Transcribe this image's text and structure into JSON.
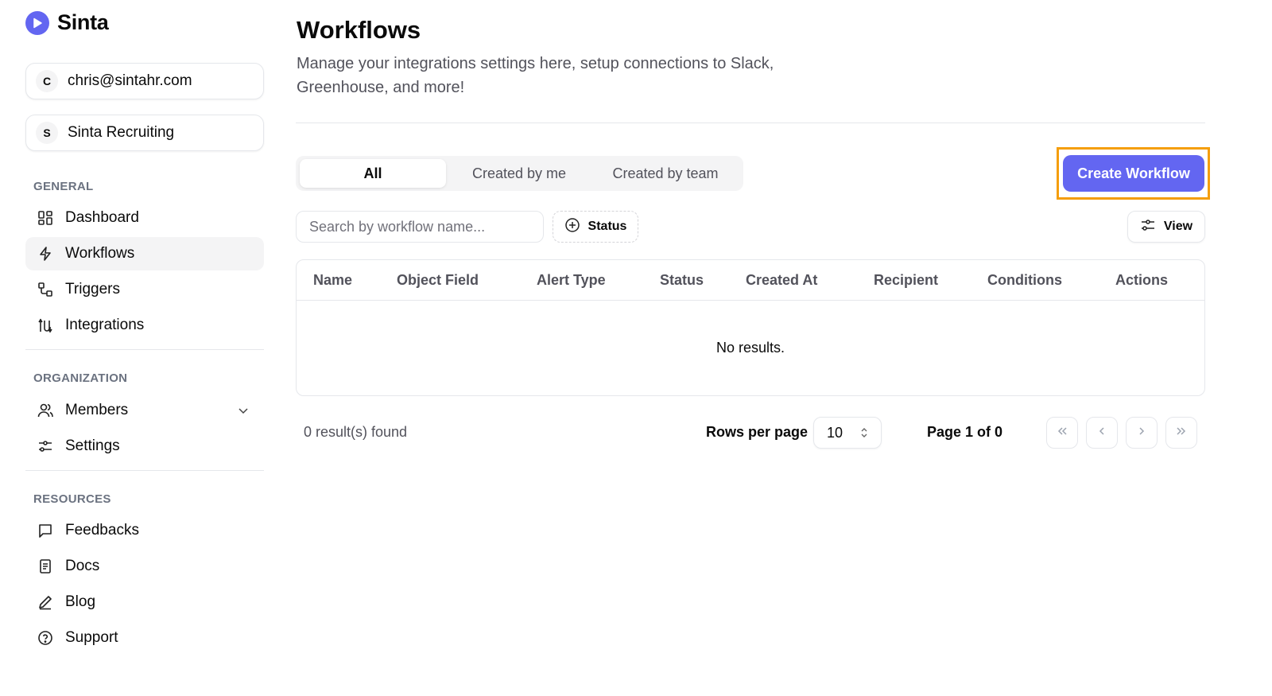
{
  "brand": {
    "name": "Sinta",
    "accent": "#6366f1"
  },
  "account": {
    "email_initial": "C",
    "email": "chris@sintahr.com",
    "org_initial": "S",
    "org": "Sinta Recruiting"
  },
  "sidebar": {
    "general_heading": "GENERAL",
    "general": [
      {
        "label": "Dashboard",
        "icon": "dashboard-icon"
      },
      {
        "label": "Workflows",
        "icon": "lightning-icon",
        "active": true
      },
      {
        "label": "Triggers",
        "icon": "triggers-icon"
      },
      {
        "label": "Integrations",
        "icon": "integrations-icon"
      }
    ],
    "organization_heading": "ORGANIZATION",
    "organization": [
      {
        "label": "Members",
        "icon": "users-icon",
        "expandable": true
      },
      {
        "label": "Settings",
        "icon": "sliders-icon"
      }
    ],
    "resources_heading": "RESOURCES",
    "resources": [
      {
        "label": "Feedbacks",
        "icon": "message-icon"
      },
      {
        "label": "Docs",
        "icon": "document-icon"
      },
      {
        "label": "Blog",
        "icon": "pen-icon"
      },
      {
        "label": "Support",
        "icon": "help-circle-icon"
      }
    ]
  },
  "main": {
    "title": "Workflows",
    "description": "Manage your integrations settings here, setup connections to Slack, Greenhouse, and more!",
    "tabs": [
      {
        "label": "All",
        "active": true
      },
      {
        "label": "Created by me"
      },
      {
        "label": "Created by team"
      }
    ],
    "create_button": "Create Workflow",
    "search_placeholder": "Search by workflow name...",
    "status_filter": "Status",
    "view_button": "View",
    "table": {
      "columns": [
        "Name",
        "Object Field",
        "Alert Type",
        "Status",
        "Created At",
        "Recipient",
        "Conditions",
        "Actions"
      ],
      "empty_message": "No results."
    },
    "footer": {
      "results": "0 result(s) found",
      "rows_per_page_label": "Rows per page",
      "rows_per_page_value": "10",
      "page_indicator": "Page 1 of 0"
    }
  }
}
